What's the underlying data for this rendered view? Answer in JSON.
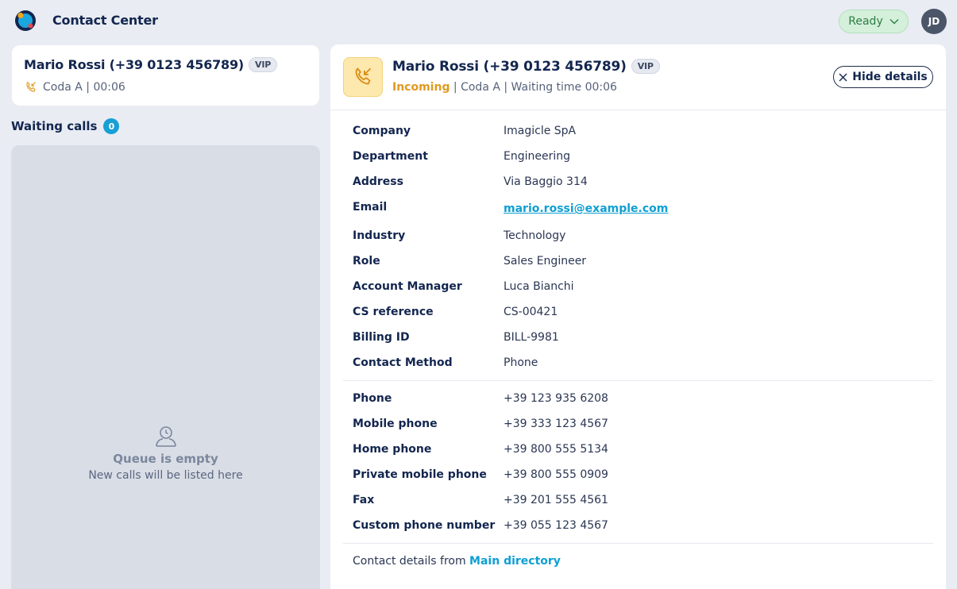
{
  "header": {
    "title": "Contact Center",
    "status_label": "Ready",
    "avatar_initials": "JD"
  },
  "active_call": {
    "name": "Mario Rossi (+39 0123 456789)",
    "vip": "VIP",
    "meta": "Coda A | 00:06"
  },
  "waiting": {
    "title": "Waiting calls",
    "count": "0",
    "empty_title": "Queue is empty",
    "empty_subtitle": "New calls will be listed here"
  },
  "detail": {
    "name": "Mario Rossi (+39 0123 456789)",
    "vip": "VIP",
    "status": "Incoming",
    "meta": " | Coda A | Waiting time 00:06",
    "hide_label": "Hide details",
    "info": [
      {
        "label": "Company",
        "value": "Imagicle SpA"
      },
      {
        "label": "Department",
        "value": "Engineering"
      },
      {
        "label": "Address",
        "value": "Via Baggio 314"
      },
      {
        "label": "Email",
        "value": "mario.rossi@example.com"
      },
      {
        "label": "Industry",
        "value": "Technology"
      },
      {
        "label": "Role",
        "value": "Sales Engineer"
      },
      {
        "label": "Account Manager",
        "value": "Luca Bianchi"
      },
      {
        "label": "CS reference",
        "value": "CS-00421"
      },
      {
        "label": "Billing ID",
        "value": "BILL-9981"
      },
      {
        "label": "Contact Method",
        "value": "Phone"
      }
    ],
    "phones": [
      {
        "label": "Phone",
        "value": "+39 123 935 6208"
      },
      {
        "label": "Mobile phone",
        "value": "+39 333 123 4567"
      },
      {
        "label": "Home phone",
        "value": "+39 800 555 5134"
      },
      {
        "label": "Private mobile phone",
        "value": "+39 800 555 0909"
      },
      {
        "label": "Fax",
        "value": "+39 201 555 4561"
      },
      {
        "label": "Custom phone number",
        "value": "+39 055 123 4567"
      }
    ],
    "source_prefix": "Contact details from ",
    "source_directory": "Main directory"
  },
  "colors": {
    "accent": "#0e9fd2",
    "incoming": "#e0991f",
    "ready_bg": "#d4f0da"
  },
  "icons": {
    "logo": "app-logo-icon",
    "status": "chevron-down-icon",
    "call": "incoming-call-icon",
    "queue": "user-clock-icon",
    "close": "close-icon"
  }
}
